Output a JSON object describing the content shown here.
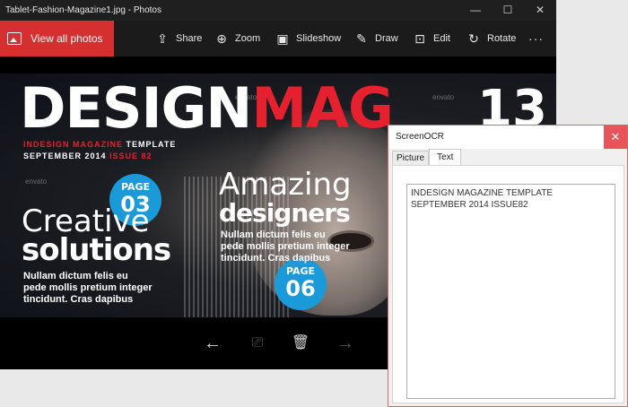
{
  "photos_window": {
    "title": "Tablet-Fashion-Magazine1.jpg - Photos",
    "controls": {
      "minimize": "—",
      "maximize": "☐",
      "close": "✕"
    },
    "toolbar": {
      "view_all": "View all photos",
      "share": "Share",
      "zoom": "Zoom",
      "slideshow": "Slideshow",
      "draw": "Draw",
      "edit": "Edit",
      "rotate": "Rotate",
      "more": "···"
    },
    "bottom": {
      "back": "←",
      "present": "⎚",
      "delete": "🗑",
      "forward": "→"
    }
  },
  "magazine": {
    "masthead_white": "DESIGN",
    "masthead_red": "MAG",
    "issue_number": "13",
    "sub1_red": "INDESIGN MAGAZINE",
    "sub1_white": " TEMPLATE",
    "sub2_white": "SEPTEMBER 2014 ",
    "sub2_red": "ISSUE 82",
    "watermark": "envato",
    "badge1": {
      "label": "PAGE",
      "number": "03"
    },
    "badge2": {
      "label": "PAGE",
      "number": "06"
    },
    "creative": "Creative",
    "solutions": "solutions",
    "lorem1": "Nullam dictum felis eu\npede mollis pretium integer\ntincidunt. Cras dapibus",
    "amazing": "Amazing",
    "designers": "designers",
    "lorem2": "Nullam dictum felis eu\npede mollis pretium integer\ntincidunt. Cras dapibus"
  },
  "ocr_window": {
    "title": "ScreenOCR",
    "close": "✕",
    "tab_picture": "Picture",
    "tab_text": "Text",
    "text": "INDESIGN MAGAZINE TEMPLATE\nSEPTEMBER 2014 ISSUE82"
  },
  "colors": {
    "accent_red": "#d62f2f",
    "badge_blue": "#1a9ad8",
    "mag_red": "#e5212f"
  }
}
